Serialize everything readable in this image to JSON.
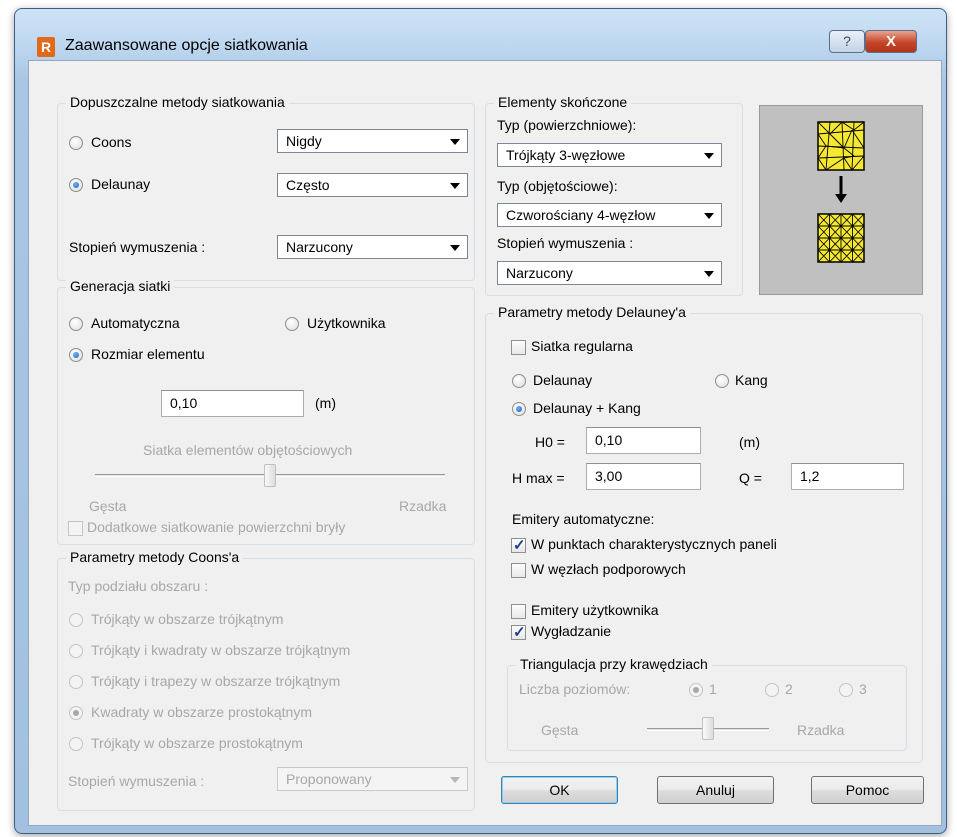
{
  "window": {
    "title": "Zaawansowane opcje siatkowania",
    "help_glyph": "?",
    "close_glyph": "X",
    "app_icon_letter": "R"
  },
  "methods": {
    "title": "Dopuszczalne metody siatkowania",
    "coons_label": "Coons",
    "coons_value": "Nigdy",
    "delaunay_label": "Delaunay",
    "delaunay_value": "Często",
    "degree_label": "Stopień wymuszenia :",
    "degree_value": "Narzucony",
    "selected": "Delaunay"
  },
  "generation": {
    "title": "Generacja siatki",
    "auto_label": "Automatyczna",
    "user_label": "Użytkownika",
    "size_label": "Rozmiar elementu",
    "selected": "Rozmiar elementu",
    "size_value": "0,10",
    "size_unit": "(m)",
    "volume_slider_label": "Siatka elementów objętościowych",
    "dense_label": "Gęsta",
    "sparse_label": "Rzadka",
    "slider_level": 0.5,
    "extra_surface_label": "Dodatkowe siatkowanie powierzchni bryły",
    "extra_surface_checked": false
  },
  "coons_params": {
    "title": "Parametry metody Coons'a",
    "division_label": "Typ podziału obszaru :",
    "options": [
      "Trójkąty w obszarze trójkątnym",
      "Trójkąty i kwadraty w obszarze trójkątnym",
      "Trójkąty i trapezy w obszarze trójkątnym",
      "Kwadraty w obszarze prostokątnym",
      "Trójkąty w obszarze prostokątnym"
    ],
    "selected": "Kwadraty w obszarze prostokątnym",
    "degree_label": "Stopień wymuszenia :",
    "degree_value": "Proponowany"
  },
  "finite_elements": {
    "title": "Elementy skończone",
    "surface_label": "Typ (powierzchniowe):",
    "surface_value": "Trójkąty 3-węzłowe",
    "volume_label": "Typ (objętościowe):",
    "volume_value": "Czworościany 4-węzłow",
    "degree_label": "Stopień wymuszenia :",
    "degree_value": "Narzucony"
  },
  "delaunay_params": {
    "title": "Parametry metody Delauney'a",
    "regular_mesh_label": "Siatka regularna",
    "regular_mesh_checked": false,
    "delaunay_label": "Delaunay",
    "kang_label": "Kang",
    "delaunay_kang_label": "Delaunay + Kang",
    "selected": "Delaunay + Kang",
    "h0_label": "H0 =",
    "h0_value": "0,10",
    "h0_unit": "(m)",
    "hmax_label": "H max =",
    "hmax_value": "3,00",
    "q_label": "Q =",
    "q_value": "1,2",
    "auto_emitters_label": "Emitery automatyczne:",
    "emit_panels_label": "W punktach charakterystycznych paneli",
    "emit_panels_checked": true,
    "emit_supports_label": "W węzłach podporowych",
    "emit_supports_checked": false,
    "user_emitters_label": "Emitery użytkownika",
    "user_emitters_checked": false,
    "smoothing_label": "Wygładzanie",
    "smoothing_checked": true
  },
  "edge_triangulation": {
    "title": "Triangulacja przy krawędziach",
    "levels_label": "Liczba poziomów:",
    "levels": [
      "1",
      "2",
      "3"
    ],
    "selected": "1",
    "dense_label": "Gęsta",
    "sparse_label": "Rzadka",
    "slider_level": 0.5
  },
  "buttons": {
    "ok": "OK",
    "cancel": "Anuluj",
    "help": "Pomoc"
  }
}
